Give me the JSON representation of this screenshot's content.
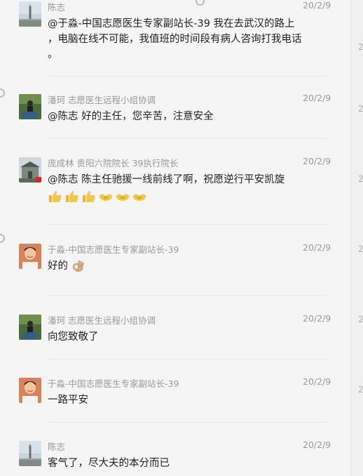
{
  "messages": [
    {
      "sender": "陈志",
      "time": "20/2/9",
      "avatar": "monument-avatar",
      "lines": [
        "@于淼-中国志愿医生专家副站长-39 我在去武汉的路上",
        "，电脑在线不可能，我值班的时间段有病人咨询打我电话",
        "。"
      ]
    },
    {
      "sender": "潘珂 志愿医生远程小组协调",
      "time": "20/2/9",
      "avatar": "park-avatar",
      "lines": [
        "@陈志 好的主任，您辛苦，注意安全"
      ]
    },
    {
      "sender": "庞成林 贵阳六院院长 39执行院长",
      "time": "20/2/9",
      "avatar": "temple-avatar",
      "lines": [
        "@陈志 陈主任驰援一线前线了啊，祝愿逆行平安凯旋"
      ],
      "emojis": [
        "thumbs-up-icon",
        "thumbs-up-icon",
        "thumbs-up-icon",
        "handshake-icon",
        "handshake-icon",
        "handshake-icon"
      ]
    },
    {
      "sender": "于淼-中国志愿医生专家副站长-39",
      "time": "20/2/9",
      "avatar": "portrait-avatar",
      "lines": [
        "好的"
      ],
      "trailing_emoji": "ok-hand-icon"
    },
    {
      "sender": "潘珂 志愿医生远程小组协调",
      "time": "20/2/9",
      "avatar": "park-avatar",
      "lines": [
        "向您致敬了"
      ]
    },
    {
      "sender": "于淼-中国志愿医生专家副站长-39",
      "time": "20/2/9",
      "avatar": "portrait-avatar",
      "lines": [
        "一路平安"
      ]
    },
    {
      "sender": "陈志",
      "time": "20/2/9",
      "avatar": "monument-avatar",
      "lines": [
        "客气了，尽大夫的本分而已"
      ]
    }
  ],
  "edge_digits": [
    "2",
    "2",
    "2",
    "2",
    "2",
    "2"
  ],
  "colors": {
    "background": "#f5f5f5",
    "meta_text": "#999999",
    "body_text": "#222222",
    "divider": "#e6e6e6"
  }
}
